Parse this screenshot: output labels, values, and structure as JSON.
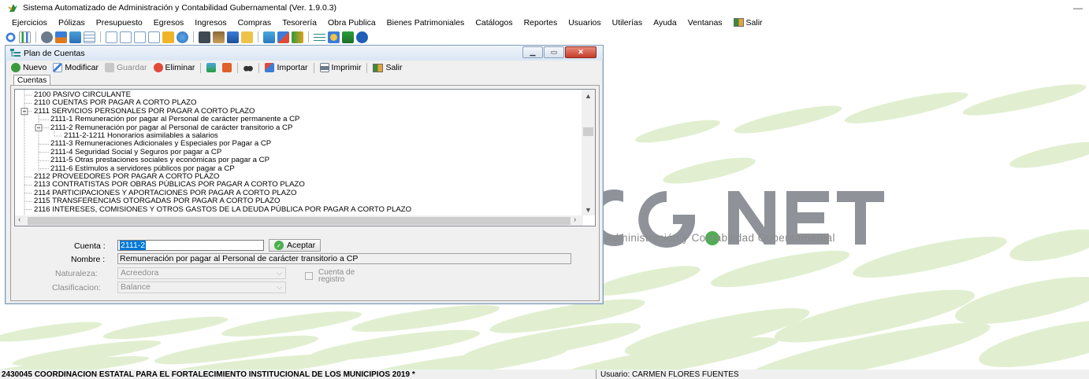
{
  "app": {
    "title": "Sistema Automatizado de Administración y Contabilidad Gubernamental  (Ver. 1.9.0.3)",
    "minimize": "—"
  },
  "menu": [
    "Ejercicios",
    "Pólizas",
    "Presupuesto",
    "Egresos",
    "Ingresos",
    "Compras",
    "Tesorería",
    "Obra Publica",
    "Bienes Patrimoniales",
    "Catálogos",
    "Reportes",
    "Usuarios",
    "Utilerías",
    "Ayuda",
    "Ventanas",
    "Salir"
  ],
  "desktop": {
    "logo_text": "Administración y Contabilidad Gubernamental",
    "logo_mark": "CG.NET"
  },
  "window": {
    "title": "Plan de Cuentas",
    "toolbar": {
      "nuevo": "Nuevo",
      "modificar": "Modificar",
      "guardar": "Guardar",
      "eliminar": "Eliminar",
      "importar": "Importar",
      "imprimir": "Imprimir",
      "salir": "Salir"
    },
    "tab": "Cuentas"
  },
  "tree": [
    {
      "text": "2100  PASIVO CIRCULANTE",
      "level": 0
    },
    {
      "text": "2110  CUENTAS POR PAGAR A CORTO PLAZO",
      "level": 0
    },
    {
      "text": "2111  SERVICIOS PERSONALES POR PAGAR A CORTO PLAZO",
      "level": 0,
      "expanded": true
    },
    {
      "text": "2111-1  Remuneración por pagar al Personal de carácter permanente a CP",
      "level": 1
    },
    {
      "text": "2111-2  Remuneración por pagar al Personal de carácter transitorio a CP",
      "level": 1,
      "expanded": true
    },
    {
      "text": "2111-2-1211  Honorarios asimilables a salarios",
      "level": 2
    },
    {
      "text": "2111-3  Remuneraciones Adicionales y Especiales por Pagar a CP",
      "level": 1
    },
    {
      "text": "2111-4  Seguridad Social y Seguros por pagar a CP",
      "level": 1
    },
    {
      "text": "2111-5  Otras prestaciones sociales y económicas por pagar a CP",
      "level": 1
    },
    {
      "text": "2111-6  Estímulos a servidores públicos por pagar a CP",
      "level": 1
    },
    {
      "text": "2112  PROVEEDORES POR PAGAR A CORTO PLAZO",
      "level": 0
    },
    {
      "text": "2113  CONTRATISTAS POR OBRAS PÚBLICAS POR PAGAR A CORTO PLAZO",
      "level": 0
    },
    {
      "text": "2114  PARTICIPACIONES Y APORTACIONES POR PAGAR A CORTO PLAZO",
      "level": 0
    },
    {
      "text": "2115  TRANSFERENCIAS OTORGADAS POR PAGAR A CORTO PLAZO",
      "level": 0
    },
    {
      "text": "2116  INTERESES, COMISIONES Y OTROS GASTOS DE LA DEUDA PÚBLICA POR PAGAR A CORTO PLAZO",
      "level": 0
    }
  ],
  "form": {
    "cuenta_label": "Cuenta :",
    "cuenta_value": "2111-2",
    "aceptar": "Aceptar",
    "nombre_label": "Nombre :",
    "nombre_value": "Remuneración por pagar al Personal de carácter transitorio a CP",
    "naturaleza_label": "Naturaleza:",
    "naturaleza_value": "Acreedora",
    "clasificacion_label": "Clasificacion:",
    "clasificacion_value": "Balance",
    "registro_label_1": "Cuenta de",
    "registro_label_2": "registro"
  },
  "status": {
    "org": "2430045 COORDINACION ESTATAL PARA EL FORTALECIMIENTO INSTITUCIONAL DE LOS MUNICIPIOS  2019   *",
    "user": "Usuario: CARMEN FLORES FUENTES"
  }
}
